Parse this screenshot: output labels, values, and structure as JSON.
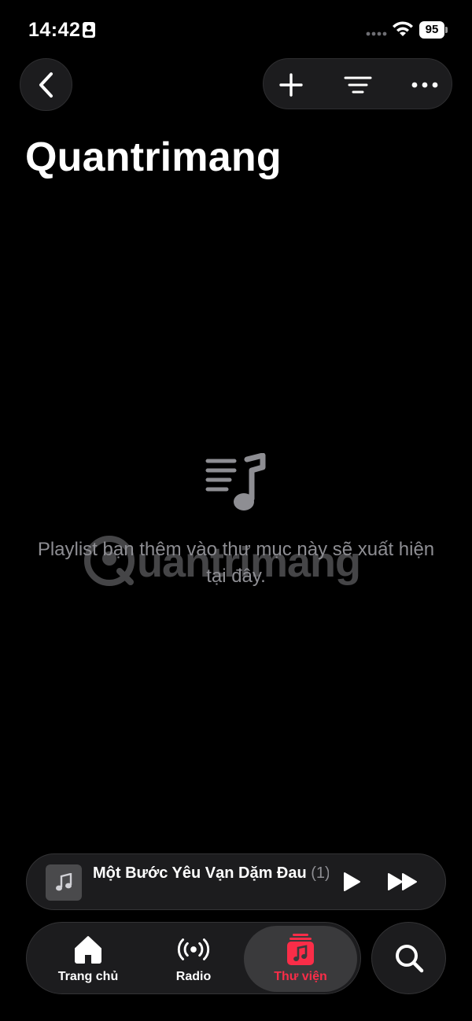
{
  "status_bar": {
    "time": "14:42",
    "battery": "95"
  },
  "header": {
    "title": "Quantrimang",
    "actions": [
      "plus-icon",
      "filter-icon",
      "more-icon"
    ]
  },
  "empty_state": {
    "message": "Playlist bạn thêm vào thư mục này sẽ xuất hiện tại đây."
  },
  "watermark": {
    "text": "uantrimang"
  },
  "mini_player": {
    "track_title": "Một Bước Yêu Vạn Dặm Đau",
    "track_suffix": " (1)"
  },
  "tabs": {
    "home": "Trang chủ",
    "radio": "Radio",
    "library": "Thư viện"
  },
  "colors": {
    "accent": "#fa2d48",
    "background": "#000000",
    "surface": "#1c1c1e"
  }
}
